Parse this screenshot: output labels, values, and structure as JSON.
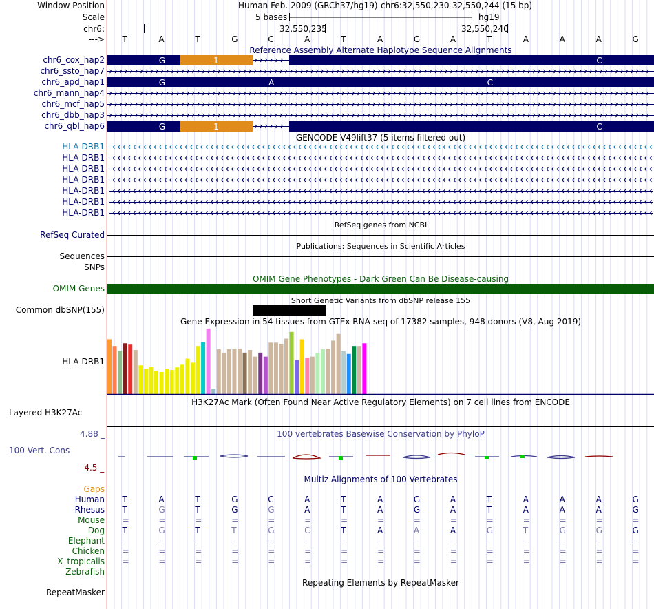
{
  "header": {
    "window_position_label": "Window Position",
    "scale_label": "Scale",
    "chrom_label": "chr6:",
    "arrow_label": "--->",
    "assembly": "Human Feb. 2009 (GRCh37/hg19)",
    "position": "chr6:32,550,230-32,550,244 (15 bp)",
    "scale_text": "5 bases",
    "db": "hg19",
    "tick1": "32,550,235",
    "tick2": "32,550,240"
  },
  "bases": [
    "T",
    "A",
    "T",
    "G",
    "C",
    "A",
    "T",
    "A",
    "G",
    "A",
    "T",
    "A",
    "A",
    "A",
    "G"
  ],
  "colors": {
    "navy": "#000066",
    "orange": "#e08c1a",
    "omim_green": "#085c08",
    "refseq_blue": "#0b71a7",
    "phylo_blue": "#3c3c8c",
    "phylo_red": "#8c0000",
    "gaps_orange": "#e08c1a"
  },
  "haplotypes": {
    "title": "Reference Assembly Alternate Haplotype Sequence Alignments",
    "tracks": [
      {
        "name": "chr6_cox_hap2",
        "style": "mid",
        "letters": [
          {
            "i": 1,
            "t": "G"
          },
          {
            "i": 3,
            "t": "1"
          },
          {
            "i": 13,
            "t": "C"
          }
        ]
      },
      {
        "name": "chr6_ssto_hap7",
        "style": "line",
        "letters": []
      },
      {
        "name": "chr6_apd_hap1",
        "style": "full",
        "letters": [
          {
            "i": 1,
            "t": "G"
          },
          {
            "i": 4,
            "t": "A"
          },
          {
            "i": 10,
            "t": "C"
          }
        ]
      },
      {
        "name": "chr6_mann_hap4",
        "style": "line",
        "letters": []
      },
      {
        "name": "chr6_mcf_hap5",
        "style": "line",
        "letters": []
      },
      {
        "name": "chr6_dbb_hap3",
        "style": "line",
        "letters": []
      },
      {
        "name": "chr6_qbl_hap6",
        "style": "mid",
        "letters": [
          {
            "i": 1,
            "t": "G"
          },
          {
            "i": 3,
            "t": "1"
          },
          {
            "i": 13,
            "t": "C"
          }
        ]
      }
    ]
  },
  "gencode": {
    "title": "GENCODE V49lift37 (5 items filtered out)",
    "genes": [
      "HLA-DRB1",
      "HLA-DRB1",
      "HLA-DRB1",
      "HLA-DRB1",
      "HLA-DRB1",
      "HLA-DRB1",
      "HLA-DRB1"
    ]
  },
  "refseq": {
    "title": "RefSeq genes from NCBI",
    "label": "RefSeq Curated"
  },
  "publications": {
    "title": "Publications: Sequences in Scientific Articles",
    "label1": "Sequences",
    "label2": "SNPs"
  },
  "omim": {
    "title": "OMIM Gene Phenotypes - Dark Green Can Be Disease-causing",
    "label": "OMIM Genes"
  },
  "dbsnp": {
    "title": "Short Genetic Variants from dbSNP release 155",
    "label": "Common dbSNP(155)"
  },
  "gtex": {
    "title": "Gene Expression in 54 tissues from GTEx RNA-seq of 17382 samples, 948 donors (V8, Aug 2019)",
    "label": "HLA-DRB1",
    "bars": [
      {
        "v": 0.82,
        "c": "#ff9a33"
      },
      {
        "v": 0.72,
        "c": "#ff7f50"
      },
      {
        "v": 0.65,
        "c": "#8fbc8f"
      },
      {
        "v": 0.76,
        "c": "#8b1a1a"
      },
      {
        "v": 0.74,
        "c": "#ee2c2c"
      },
      {
        "v": 0.66,
        "c": "#cdb79e"
      },
      {
        "v": 0.43,
        "c": "#eeee00"
      },
      {
        "v": 0.38,
        "c": "#eeee00"
      },
      {
        "v": 0.41,
        "c": "#eeee00"
      },
      {
        "v": 0.35,
        "c": "#eeee00"
      },
      {
        "v": 0.33,
        "c": "#eeee00"
      },
      {
        "v": 0.38,
        "c": "#eeee00"
      },
      {
        "v": 0.36,
        "c": "#eeee00"
      },
      {
        "v": 0.4,
        "c": "#eeee00"
      },
      {
        "v": 0.44,
        "c": "#eeee00"
      },
      {
        "v": 0.53,
        "c": "#eeee00"
      },
      {
        "v": 0.47,
        "c": "#eeee00"
      },
      {
        "v": 0.72,
        "c": "#eeee00"
      },
      {
        "v": 0.78,
        "c": "#00cdcd"
      },
      {
        "v": 0.98,
        "c": "#ee82ee"
      },
      {
        "v": 0.08,
        "c": "#9ac0cd"
      },
      {
        "v": 0.67,
        "c": "#cdb79e"
      },
      {
        "v": 0.62,
        "c": "#cdb79e"
      },
      {
        "v": 0.67,
        "c": "#cdb79e"
      },
      {
        "v": 0.67,
        "c": "#cdb79e"
      },
      {
        "v": 0.68,
        "c": "#cdb79e"
      },
      {
        "v": 0.62,
        "c": "#8b7355"
      },
      {
        "v": 0.66,
        "c": "#cdb79e"
      },
      {
        "v": 0.56,
        "c": "#cdb79e"
      },
      {
        "v": 0.62,
        "c": "#7a378b"
      },
      {
        "v": 0.56,
        "c": "#b452cd"
      },
      {
        "v": 0.77,
        "c": "#cdb79e"
      },
      {
        "v": 0.77,
        "c": "#cdb79e"
      },
      {
        "v": 0.75,
        "c": "#cdb79e"
      },
      {
        "v": 0.83,
        "c": "#cdb79e"
      },
      {
        "v": 0.93,
        "c": "#9acd32"
      },
      {
        "v": 0.51,
        "c": "#7b68ee"
      },
      {
        "v": 0.82,
        "c": "#ffd700"
      },
      {
        "v": 0.54,
        "c": "#ff82ab"
      },
      {
        "v": 0.56,
        "c": "#cdb79e"
      },
      {
        "v": 0.62,
        "c": "#b4eeb4"
      },
      {
        "v": 0.67,
        "c": "#b4eeb4"
      },
      {
        "v": 0.68,
        "c": "#cdb79e"
      },
      {
        "v": 0.8,
        "c": "#cdb79e"
      },
      {
        "v": 0.9,
        "c": "#cdb79e"
      },
      {
        "v": 0.64,
        "c": "#b4cdcd"
      },
      {
        "v": 0.6,
        "c": "#1e90ff"
      },
      {
        "v": 0.72,
        "c": "#008b45"
      },
      {
        "v": 0.72,
        "c": "#cdb79e"
      },
      {
        "v": 0.76,
        "c": "#ff00ff"
      }
    ]
  },
  "h3k27ac": {
    "title": "H3K27Ac Mark (Often Found Near Active Regulatory Elements) on 7 cell lines from ENCODE",
    "label": "Layered H3K27Ac"
  },
  "phylop": {
    "title": "100 vertebrates Basewise Conservation by PhyloP",
    "label": "100 Vert. Cons",
    "ymax": "4.88 _",
    "ymin": "-4.5 _"
  },
  "multiz": {
    "title": "Multiz Alignments of 100 Vertebrates",
    "gaps_label": "Gaps",
    "species": [
      {
        "name": "Human",
        "style": "navy",
        "cells": [
          "T",
          "A",
          "T",
          "G",
          "C",
          "A",
          "T",
          "A",
          "G",
          "A",
          "T",
          "A",
          "A",
          "A",
          "G"
        ],
        "match": [
          1,
          1,
          1,
          1,
          1,
          1,
          1,
          1,
          1,
          1,
          1,
          1,
          1,
          1,
          1
        ]
      },
      {
        "name": "Rhesus",
        "style": "navy",
        "cells": [
          "T",
          "G",
          "T",
          "G",
          "G",
          "A",
          "T",
          "A",
          "G",
          "A",
          "T",
          "A",
          "A",
          "A",
          "G"
        ],
        "match": [
          1,
          0,
          1,
          1,
          0,
          1,
          1,
          1,
          1,
          1,
          1,
          1,
          1,
          1,
          1
        ]
      },
      {
        "name": "Mouse",
        "style": "green",
        "cells": [
          "=",
          "=",
          "=",
          "=",
          "=",
          "=",
          "=",
          "=",
          "=",
          "=",
          "=",
          "=",
          "=",
          "=",
          "="
        ],
        "match": [
          0,
          0,
          0,
          0,
          0,
          0,
          0,
          0,
          0,
          0,
          0,
          0,
          0,
          0,
          0
        ]
      },
      {
        "name": "Dog",
        "style": "green",
        "cells": [
          "T",
          "G",
          "T",
          "T",
          "G",
          "C",
          "T",
          "A",
          "A",
          "A",
          "G",
          "T",
          "G",
          "G",
          "G"
        ],
        "match": [
          1,
          0,
          1,
          0,
          0,
          0,
          1,
          1,
          0,
          1,
          0,
          0,
          0,
          0,
          1
        ]
      },
      {
        "name": "Elephant",
        "style": "green",
        "cells": [
          "-",
          "-",
          "-",
          "-",
          "-",
          "-",
          "-",
          "-",
          "-",
          "-",
          "-",
          "-",
          "-",
          "-",
          "-"
        ],
        "match": [
          0,
          0,
          0,
          0,
          0,
          0,
          0,
          0,
          0,
          0,
          0,
          0,
          0,
          0,
          0
        ]
      },
      {
        "name": "Chicken",
        "style": "green",
        "cells": [
          "=",
          "=",
          "=",
          "=",
          "=",
          "=",
          "=",
          "=",
          "=",
          "=",
          "=",
          "=",
          "=",
          "=",
          "="
        ],
        "match": [
          0,
          0,
          0,
          0,
          0,
          0,
          0,
          0,
          0,
          0,
          0,
          0,
          0,
          0,
          0
        ]
      },
      {
        "name": "X_tropicalis",
        "style": "green",
        "cells": [
          "=",
          "=",
          "=",
          "=",
          "=",
          "=",
          "=",
          "=",
          "=",
          "=",
          "=",
          "=",
          "=",
          "=",
          "="
        ],
        "match": [
          0,
          0,
          0,
          0,
          0,
          0,
          0,
          0,
          0,
          0,
          0,
          0,
          0,
          0,
          0
        ]
      },
      {
        "name": "Zebrafish",
        "style": "green",
        "cells": [
          "",
          "",
          "",
          "",
          "",
          "",
          "",
          "",
          "",
          "",
          "",
          "",
          "",
          "",
          ""
        ],
        "match": [
          0,
          0,
          0,
          0,
          0,
          0,
          0,
          0,
          0,
          0,
          0,
          0,
          0,
          0,
          0
        ]
      }
    ]
  },
  "repeatmasker": {
    "title": "Repeating Elements by RepeatMasker",
    "label": "RepeatMasker"
  }
}
